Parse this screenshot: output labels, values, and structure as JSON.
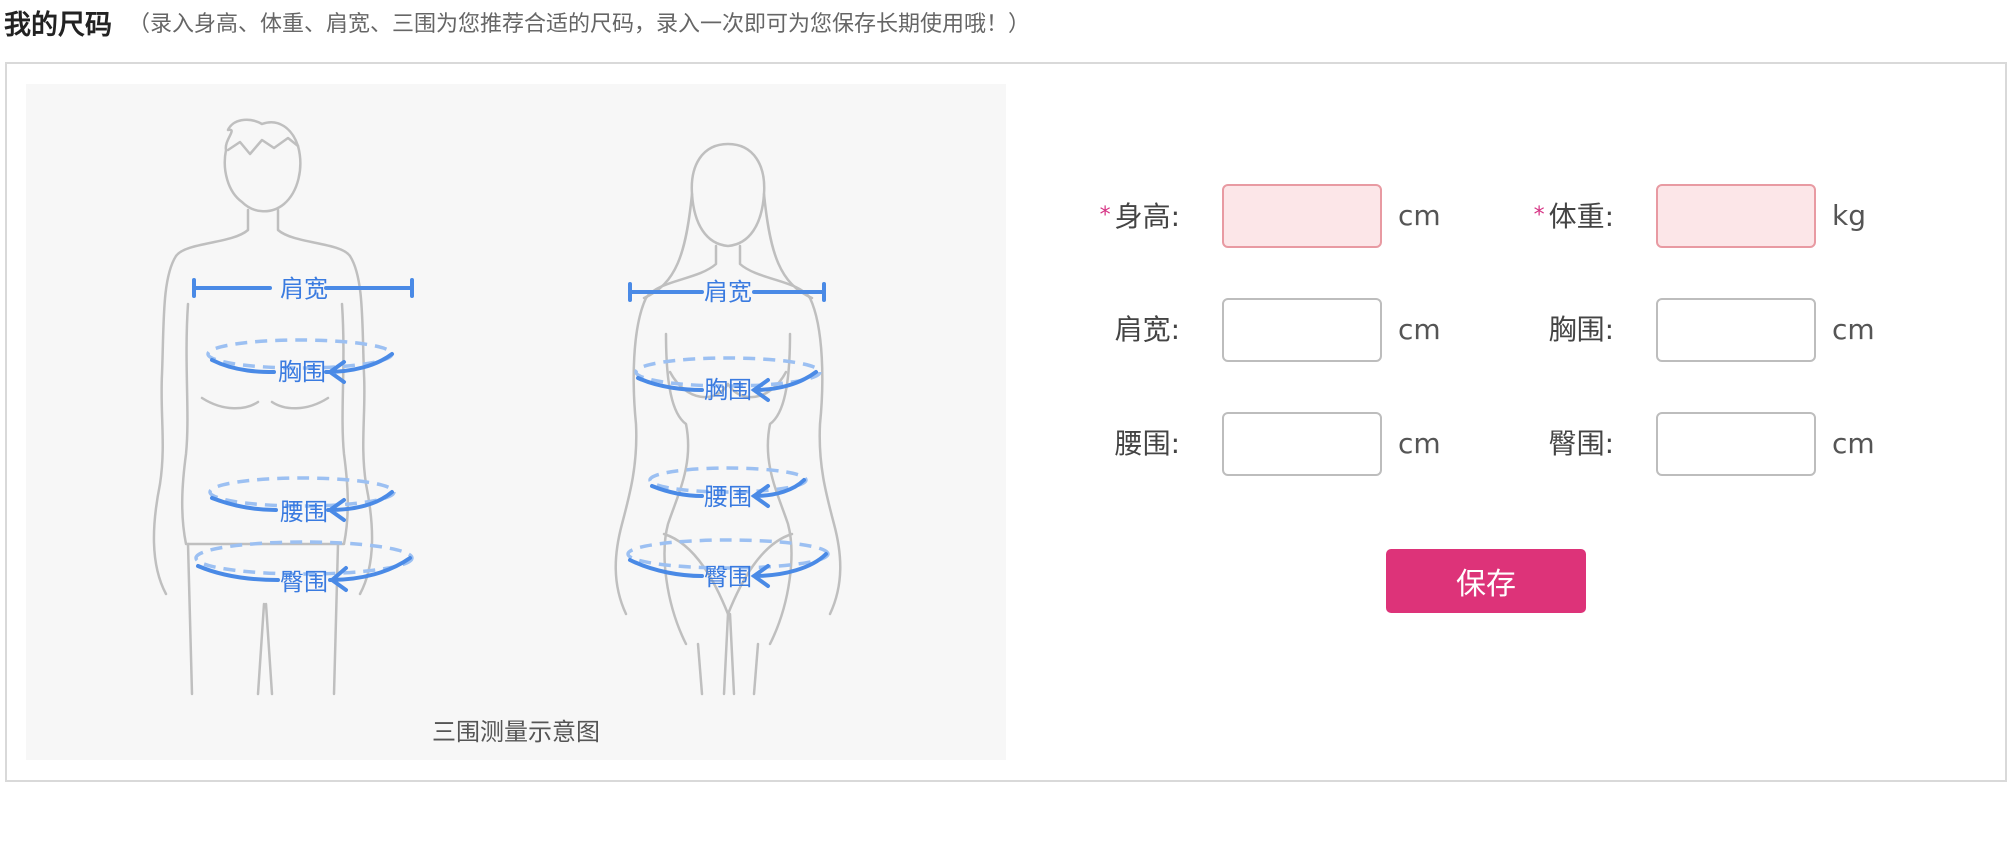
{
  "header": {
    "title": "我的尺码",
    "hint": "（录入身高、体重、肩宽、三围为您推荐合适的尺码，录入一次即可为您保存长期使用哦！）"
  },
  "illustration": {
    "caption": "三围测量示意图",
    "measure_labels": {
      "shoulder": "肩宽",
      "chest": "胸围",
      "waist": "腰围",
      "hip": "臀围"
    }
  },
  "form": {
    "required_mark": "*",
    "fields": [
      {
        "label": "身高:",
        "unit": "cm",
        "value": "",
        "required": true
      },
      {
        "label": "体重:",
        "unit": "kg",
        "value": "",
        "required": true
      },
      {
        "label": "肩宽:",
        "unit": "cm",
        "value": "",
        "required": false
      },
      {
        "label": "胸围:",
        "unit": "cm",
        "value": "",
        "required": false
      },
      {
        "label": "腰围:",
        "unit": "cm",
        "value": "",
        "required": false
      },
      {
        "label": "臀围:",
        "unit": "cm",
        "value": "",
        "required": false
      }
    ],
    "save_label": "保存"
  },
  "colors": {
    "accent": "#dd3379",
    "required_bg": "#fce6e8",
    "measure_line": "#4a8ae6"
  }
}
